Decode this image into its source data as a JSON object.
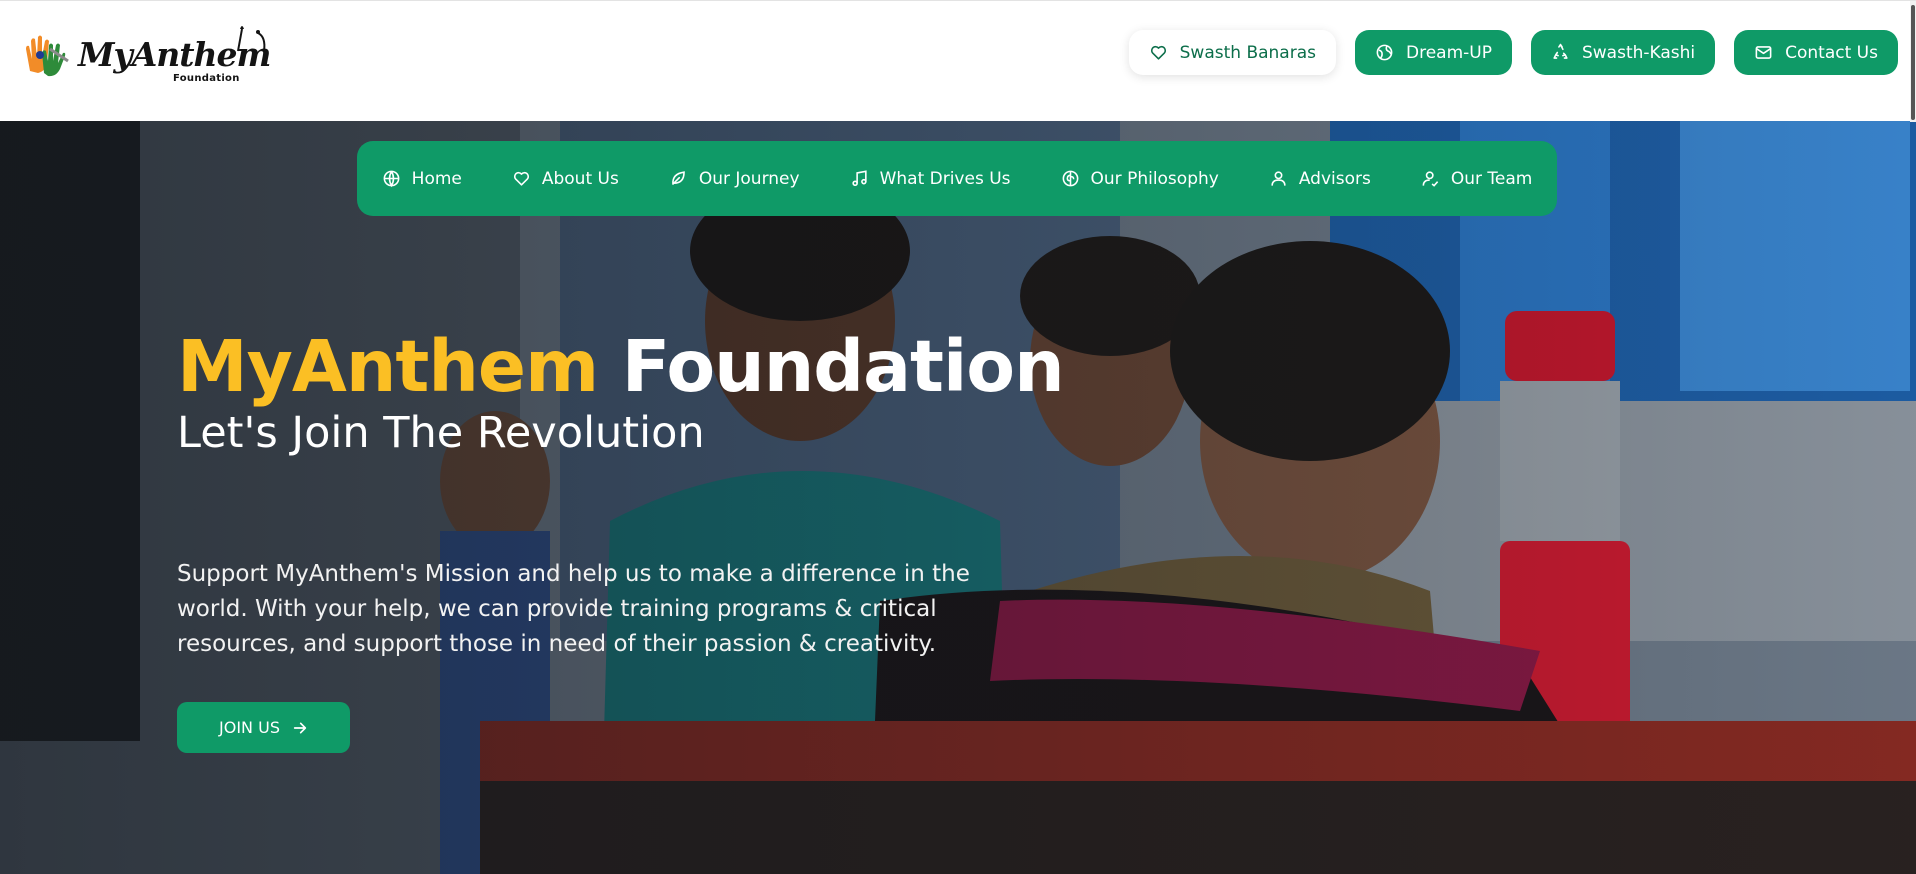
{
  "logo": {
    "wordmark": "MyAnthem",
    "subtitle": "Foundation"
  },
  "top_buttons": [
    {
      "label": "Swasth Banaras",
      "icon": "heart-icon"
    },
    {
      "label": "Dream-UP",
      "icon": "globe-icon"
    },
    {
      "label": "Swasth-Kashi",
      "icon": "recycle-icon"
    },
    {
      "label": "Contact Us",
      "icon": "mail-icon"
    }
  ],
  "nav": [
    {
      "label": "Home",
      "icon": "globe-icon"
    },
    {
      "label": "About Us",
      "icon": "heart-icon"
    },
    {
      "label": "Our Journey",
      "icon": "leaf-icon"
    },
    {
      "label": "What Drives Us",
      "icon": "music-note-icon"
    },
    {
      "label": "Our Philosophy",
      "icon": "brain-icon"
    },
    {
      "label": "Advisors",
      "icon": "user-icon"
    },
    {
      "label": "Our Team",
      "icon": "user-check-icon"
    }
  ],
  "hero": {
    "title_accent": "MyAnthem",
    "title_rest": "Foundation",
    "subtitle": "Let's Join The Revolution",
    "description": "Support MyAnthem's Mission and help us to make a difference in the world. With your help, we can provide training programs & critical resources, and support those in need of their passion & creativity.",
    "cta_label": "JOIN US"
  },
  "colors": {
    "brand_green": "#0f9a67",
    "accent_yellow": "#fbbf24",
    "text_dark_green": "#0c6e4a"
  }
}
